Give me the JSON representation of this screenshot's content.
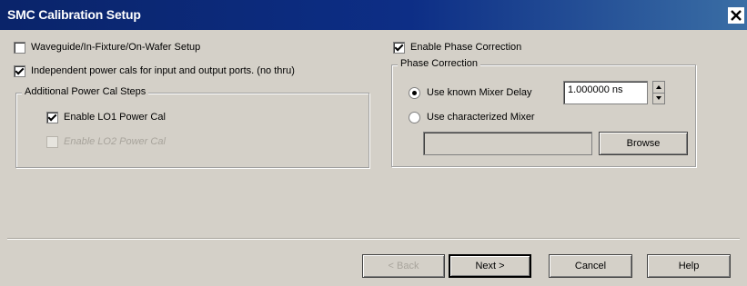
{
  "window": {
    "title": "SMC Calibration Setup",
    "close_label": "✕"
  },
  "options": {
    "waveguide": {
      "label": "Waveguide/In-Fixture/On-Wafer Setup",
      "checked": false
    },
    "independent": {
      "label": "Independent power cals for input and output ports. (no thru)",
      "checked": true
    }
  },
  "power_cal_group": {
    "legend": "Additional Power Cal Steps",
    "lo1": {
      "label": "Enable LO1 Power Cal",
      "checked": true
    },
    "lo2": {
      "label": "Enable LO2 Power Cal",
      "checked": false,
      "disabled": true
    }
  },
  "phase": {
    "enable": {
      "label": "Enable Phase Correction",
      "checked": true
    },
    "group_legend": "Phase Correction",
    "known_delay": {
      "label": "Use known Mixer Delay",
      "selected": true,
      "value": "1.000000 ns"
    },
    "characterized": {
      "label": "Use characterized Mixer",
      "selected": false,
      "path_value": ""
    },
    "browse_label": "Browse"
  },
  "footer": {
    "back_label": "< Back",
    "next_label": "Next >",
    "cancel_label": "Cancel",
    "help_label": "Help"
  }
}
